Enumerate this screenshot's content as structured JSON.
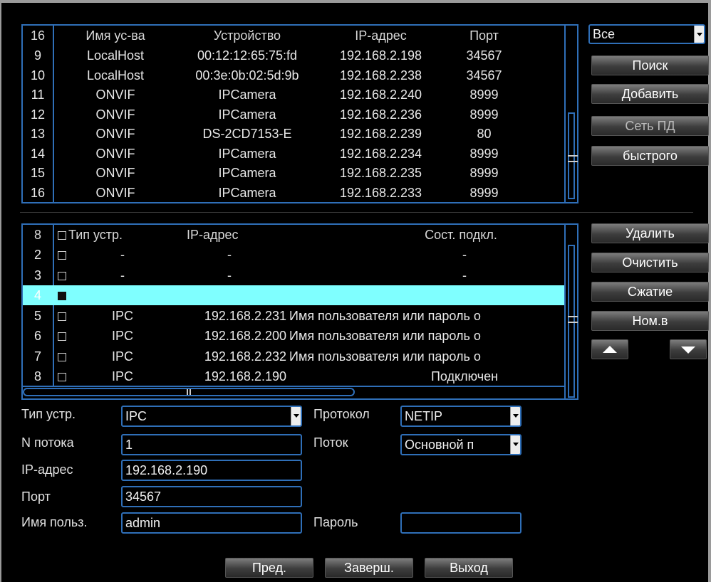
{
  "search_table": {
    "header": [
      "16",
      "Имя ус-ва",
      "Устройство",
      "IP-адрес",
      "Порт"
    ],
    "rows": [
      [
        "9",
        "LocalHost",
        "00:12:12:65:75:fd",
        "192.168.2.198",
        "34567"
      ],
      [
        "10",
        "LocalHost",
        "00:3e:0b:02:5d:9b",
        "192.168.2.238",
        "34567"
      ],
      [
        "11",
        "ONVIF",
        "IPCamera",
        "192.168.2.240",
        "8999"
      ],
      [
        "12",
        "ONVIF",
        "IPCamera",
        "192.168.2.236",
        "8999"
      ],
      [
        "13",
        "ONVIF",
        "DS-2CD7153-E",
        "192.168.2.239",
        "80"
      ],
      [
        "14",
        "ONVIF",
        "IPCamera",
        "192.168.2.234",
        "8999"
      ],
      [
        "15",
        "ONVIF",
        "IPCamera",
        "192.168.2.235",
        "8999"
      ],
      [
        "16",
        "ONVIF",
        "IPCamera",
        "192.168.2.233",
        "8999"
      ]
    ]
  },
  "filter_select": {
    "value": "Все"
  },
  "right_buttons_top": [
    "Поиск",
    "Добавить",
    "Сеть ПД",
    "быстрого"
  ],
  "added_table": {
    "header": [
      "8",
      "Тип устр.",
      "IP-адрес",
      "Сост. подкл."
    ],
    "rows": [
      [
        "2",
        "-",
        "-",
        "-"
      ],
      [
        "3",
        "-",
        "-",
        "-"
      ],
      [
        "4",
        "",
        "",
        ""
      ],
      [
        "5",
        "IPC",
        "192.168.2.231",
        "Имя пользователя или пароль о"
      ],
      [
        "6",
        "IPC",
        "192.168.2.200",
        "Имя пользователя или пароль о"
      ],
      [
        "7",
        "IPC",
        "192.168.2.232",
        "Имя пользователя или пароль о"
      ],
      [
        "8",
        "IPC",
        "192.168.2.190",
        "Подключен"
      ]
    ],
    "selected_row": "4"
  },
  "right_buttons_bottom": [
    "Удалить",
    "Очистить",
    "Сжатие",
    "Ном.в"
  ],
  "form": {
    "device_type_label": "Тип устр.",
    "device_type_value": "IPC",
    "protocol_label": "Протокол",
    "protocol_value": "NETIP",
    "channel_label": "N потока",
    "channel_value": "1",
    "stream_label": "Поток",
    "stream_value": "Основной п",
    "ip_label": "IP-адрес",
    "ip_value": "192.168.2.190",
    "port_label": "Порт",
    "port_value": "34567",
    "user_label": "Имя польз.",
    "user_value": "admin",
    "password_label": "Пароль",
    "password_value": ""
  },
  "bottom_buttons": [
    "Пред.",
    "Заверш.",
    "Выход"
  ],
  "colors": {
    "border": "#2f6fb8",
    "selected_row": "#7fffff",
    "background": "#000000"
  },
  "icons": {
    "up": "triangle-up-icon",
    "down": "triangle-down-icon",
    "dropdown": "chevron-down-icon"
  }
}
